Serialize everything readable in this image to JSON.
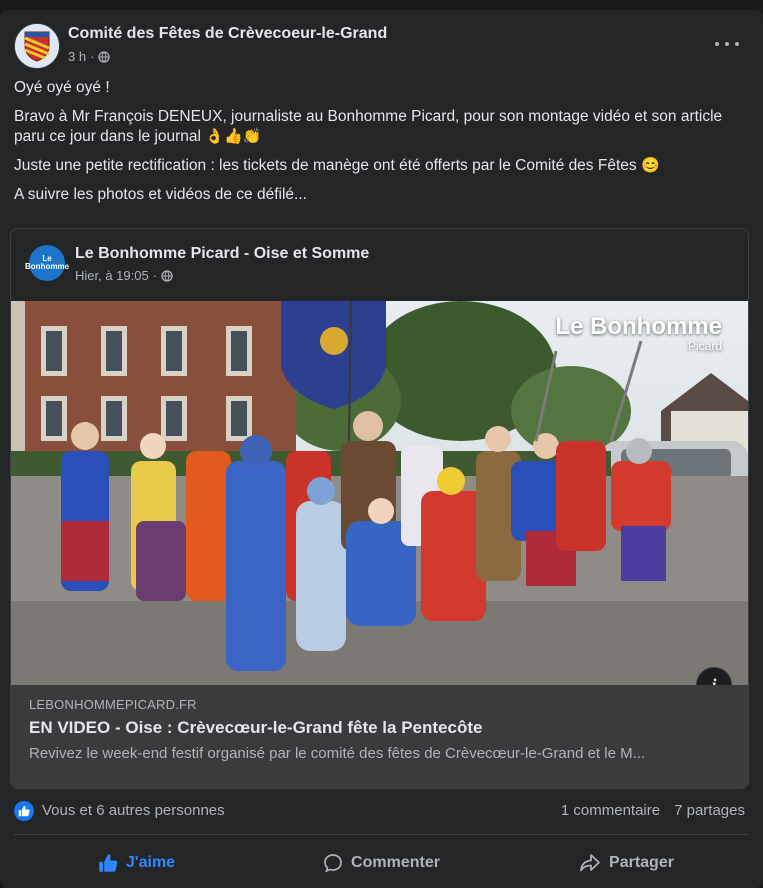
{
  "post": {
    "page_name": "Comité des Fêtes de Crèvecoeur-le-Grand",
    "time": "3 h",
    "paragraphs": [
      "Oyé oyé oyé !",
      "Bravo à Mr François DENEUX, journaliste au Bonhomme Picard, pour son montage vidéo et son article paru ce jour dans le journal",
      "Juste une petite rectification : les tickets de manège ont été offerts par le Comité des Fêtes",
      "A suivre les photos et vidéos de ce défilé..."
    ],
    "emojis": {
      "p2": "👌👍👏",
      "p3": "😊"
    }
  },
  "shared": {
    "avatar_text": "Le Bonhomme",
    "page_name": "Le Bonhomme Picard - Oise et Somme",
    "time": "Hier, à 19:05",
    "watermark": "Le Bonhomme",
    "watermark_sub": "Picard",
    "link": {
      "domain": "LEBONHOMMEPICARD.FR",
      "title": "EN VIDEO - Oise : Crèvecœur-le-Grand fête la Pentecôte",
      "description": "Revivez le week-end festif organisé par le comité des fêtes de Crèvecœur-le-Grand et le M..."
    }
  },
  "footer": {
    "reactions": "Vous et 6 autres personnes",
    "comments": "1 commentaire",
    "shares": "7 partages",
    "like": "J'aime",
    "comment": "Commenter",
    "share": "Partager"
  },
  "colors": {
    "background": "#18191a",
    "card": "#242526",
    "accent": "#2d88ff",
    "text": "#e4e6eb",
    "secondary": "#b0b3b8"
  }
}
